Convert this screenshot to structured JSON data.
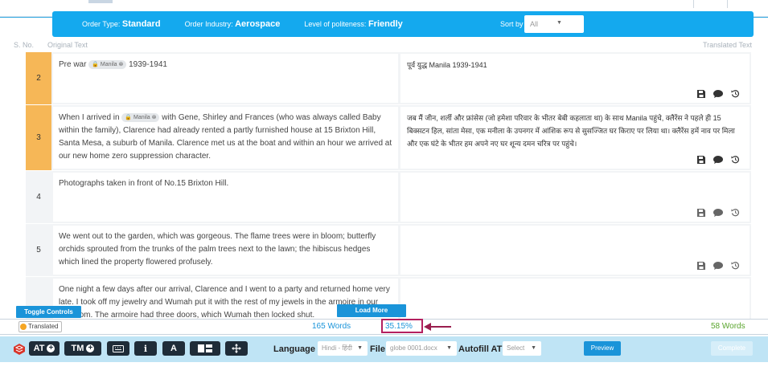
{
  "order": {
    "type_label": "Order Type:",
    "type_value": "Standard",
    "industry_label": "Order Industry:",
    "industry_value": "Aerospace",
    "politeness_label": "Level of politeness:",
    "politeness_value": "Friendly",
    "sort_label": "Sort by",
    "sort_value": "All"
  },
  "columns": {
    "sno": "S. No.",
    "original": "Original Text",
    "translated": "Translated Text"
  },
  "segments": [
    {
      "num": "2",
      "src_pre": "Pre war ",
      "tag": "Manila",
      "src_post": " 1939-1941",
      "tgt": "पूर्व युद्ध Manila 1939-1941"
    },
    {
      "num": "3",
      "src_pre": "When I arrived in ",
      "tag": "Manila",
      "src_post": " with Gene, Shirley and Frances (who was always called Baby within the family), Clarence had already rented a partly furnished house at 15 Brixton Hill, Santa Mesa, a suburb of Manila. Clarence met us at the boat and within an hour we arrived at our new home zero suppression character.",
      "tgt": "जब मैं जीन, शर्ली और फ्रांसेस (जो हमेशा परिवार के भीतर बेबी कहलाता था) के साथ Manila पहुंचे, क्लैरेंस ने पहले ही 15 बिक्सटन हिल, सांता मेसा, एक मनीला के उपनगर में आंशिक रूप से सुसज्जित घर किराए पर लिया था। क्लैरेंस हमें नाव पर मिला और एक घंटे के भीतर हम अपने नए घर शून्य दमन चरित्र पर पहुंचे।"
    },
    {
      "num": "4",
      "src": "Photographs taken in front of No.15 Brixton Hill.",
      "tgt": ""
    },
    {
      "num": "5",
      "src": "We went out to the garden, which was gorgeous. The flame trees were in bloom; butterfly orchids sprouted from the trunks of the palm trees next to the lawn; the hibiscus hedges which lined the property flowered profusely.",
      "tgt": ""
    },
    {
      "num": "",
      "src": "One night a few days after our arrival, Clarence and I went to a party and returned home very late. I took off my jewelry and Wumah put it with the rest of my jewels in the armoire in our bedroom. The armoire had three doors, which Wumah then locked shut.",
      "tgt": ""
    }
  ],
  "controls": {
    "toggle": "Toggle Controls",
    "load_more": "Load More"
  },
  "status": {
    "translated": "Translated",
    "words": "165 Words",
    "percent": "35.15%",
    "words_right": "58 Words"
  },
  "toolbar": {
    "at": "AT",
    "tm": "TM",
    "language_label": "Language",
    "language_value": "Hindi - हिंदी",
    "file_label": "File",
    "file_value": "globe 0001.docx",
    "autofill_label": "Autofill AT",
    "autofill_value": "Select",
    "preview": "Preview",
    "complete": "Complete"
  }
}
